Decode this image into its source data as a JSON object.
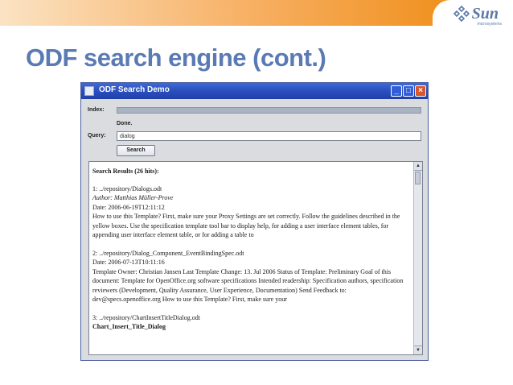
{
  "slide": {
    "title": "ODF search engine (cont.)",
    "logo_text": "Sun",
    "logo_sub": "microsystems"
  },
  "window": {
    "title": "ODF Search Demo",
    "buttons": {
      "minimize": "_",
      "maximize": "□",
      "close": "×"
    }
  },
  "form": {
    "index_label": "Index:",
    "status_text": "Done.",
    "query_label": "Query:",
    "query_value": "dialog",
    "search_button": "Search",
    "progress_fraction": 1.0
  },
  "results": {
    "header": "Search Results (26 hits):",
    "items": [
      {
        "path": "1: ../repository/Dialogs.odt",
        "author": "Author: Matthias Müller-Prove",
        "date": "Date: 2006-06-19T12:11:12",
        "snippet": "How to use this Template? First, make sure your Proxy Settings are set correctly. Follow the guidelines described in the yellow boxes. Use the specification template tool bar to display help, for adding a user interface element tables, for appending user interface element table, or for adding a table to"
      },
      {
        "path": "2: ../repository/Dialog_Component_EventBindingSpec.odt",
        "date": "Date: 2006-07-13T10:11:16",
        "snippet": "Template Owner: Christian Jansen Last Template Change: 13. Jul 2006 Status of Template: Preliminary Goal of this document: Template for OpenOffice.org software specifications Intended readership: Specification authors, specification reviewers (Development, Quality Assurance, User Experience, Documentation) Send Feedback to: dev@specs.openoffice.org How to use this Template? First, make sure your"
      },
      {
        "path": "3: ../repository/ChartInsertTitleDialog.odt",
        "bold": "Chart_Insert_Title_Dialog"
      }
    ]
  },
  "icons": {
    "window": "window-icon",
    "scroll_up": "▲",
    "scroll_down": "▼"
  },
  "colors": {
    "title": "#5a7ab4",
    "titlebar": "#2a4fbf",
    "header_accent": "#f0901e"
  }
}
